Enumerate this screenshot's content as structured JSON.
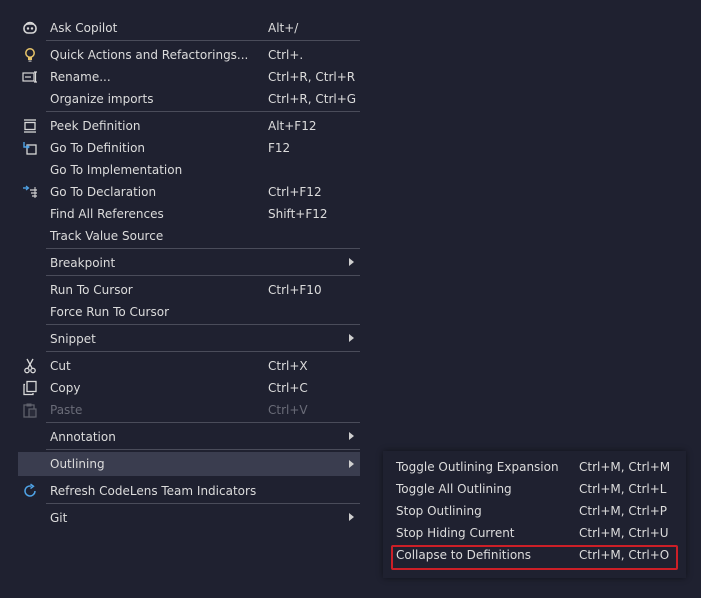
{
  "main_menu": {
    "items": [
      {
        "label": "Ask Copilot",
        "shortcut": "Alt+/",
        "icon": "copilot-icon"
      },
      {
        "label": "Quick Actions and Refactorings...",
        "shortcut": "Ctrl+.",
        "icon": "lightbulb-icon"
      },
      {
        "label": "Rename...",
        "shortcut": "Ctrl+R, Ctrl+R",
        "icon": "rename-icon"
      },
      {
        "label": "Organize imports",
        "shortcut": "Ctrl+R, Ctrl+G"
      },
      {
        "label": "Peek Definition",
        "shortcut": "Alt+F12",
        "icon": "peek-definition-icon"
      },
      {
        "label": "Go To Definition",
        "shortcut": "F12",
        "icon": "go-to-definition-icon"
      },
      {
        "label": "Go To Implementation",
        "shortcut": ""
      },
      {
        "label": "Go To Declaration",
        "shortcut": "Ctrl+F12",
        "icon": "go-to-declaration-icon"
      },
      {
        "label": "Find All References",
        "shortcut": "Shift+F12"
      },
      {
        "label": "Track Value Source",
        "shortcut": ""
      },
      {
        "label": "Breakpoint",
        "shortcut": ""
      },
      {
        "label": "Run To Cursor",
        "shortcut": "Ctrl+F10"
      },
      {
        "label": "Force Run To Cursor",
        "shortcut": ""
      },
      {
        "label": "Snippet",
        "shortcut": ""
      },
      {
        "label": "Cut",
        "shortcut": "Ctrl+X",
        "icon": "scissors-icon"
      },
      {
        "label": "Copy",
        "shortcut": "Ctrl+C",
        "icon": "copy-icon"
      },
      {
        "label": "Paste",
        "shortcut": "Ctrl+V",
        "icon": "paste-icon"
      },
      {
        "label": "Annotation",
        "shortcut": ""
      },
      {
        "label": "Outlining",
        "shortcut": ""
      },
      {
        "label": "Refresh CodeLens Team Indicators",
        "shortcut": "",
        "icon": "refresh-icon"
      },
      {
        "label": "Git",
        "shortcut": ""
      }
    ]
  },
  "outlining_submenu": {
    "items": [
      {
        "label": "Toggle Outlining Expansion",
        "shortcut": "Ctrl+M, Ctrl+M"
      },
      {
        "label": "Toggle All Outlining",
        "shortcut": "Ctrl+M, Ctrl+L"
      },
      {
        "label": "Stop Outlining",
        "shortcut": "Ctrl+M, Ctrl+P"
      },
      {
        "label": "Stop Hiding Current",
        "shortcut": "Ctrl+M, Ctrl+U"
      },
      {
        "label": "Collapse to Definitions",
        "shortcut": "Ctrl+M, Ctrl+O"
      }
    ]
  },
  "colors": {
    "background": "#1f2130",
    "highlight": "#3a3d4f",
    "separator": "#4a4c5a",
    "callout": "#cc1f27",
    "disabled_text": "#6a6c78"
  }
}
